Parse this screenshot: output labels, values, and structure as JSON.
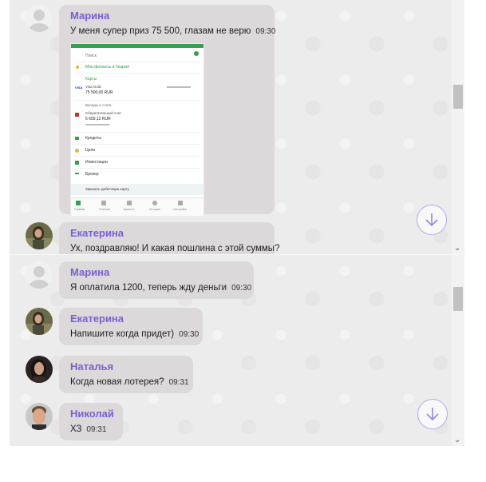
{
  "top_chat": {
    "messages": [
      {
        "name": "Марина",
        "text": "У меня супер приз 75 500, глазам не верю",
        "time": "09:30",
        "avatar": "default-avatar-icon"
      },
      {
        "name": "Екатерина",
        "text": "Ух, поздравляю! И какая пошлина с этой суммы?",
        "time": "",
        "avatar": "user-photo"
      }
    ],
    "scroll_button": "scroll-down-icon"
  },
  "screenshot_app": {
    "menu_items": [
      "Поиск",
      "Мои финансы в бюджет",
      "Карты",
      "Вклады и счета",
      "Кредиты",
      "Цели",
      "Инвестиции",
      "Брокер"
    ],
    "card_label": "Visa Gold",
    "card_amount": "75 500,00 RUR",
    "account_label": "Сберегательный счет",
    "account_amount": "6 659,12 RUR",
    "footer": "Заказать дебетовую карту",
    "tabs": [
      "Главная",
      "Платежи",
      "Диалоги",
      "История",
      "Настройки"
    ]
  },
  "bottom_chat": {
    "messages": [
      {
        "name": "Марина",
        "text": "Я оплатила 1200, теперь жду деньги",
        "time": "09:30"
      },
      {
        "name": "Екатерина",
        "text": "Напишите когда придет)",
        "time": "09:30"
      },
      {
        "name": "Наталья",
        "text": "Когда новая лотерея?",
        "time": "09:31"
      },
      {
        "name": "Николай",
        "text": "ХЗ",
        "time": "09:31"
      }
    ]
  },
  "colors": {
    "name": "#7a5fcf",
    "bubble": "#ddd9da",
    "background": "#ececec",
    "accent": "#b8a6e8",
    "app_green": "#35a04f"
  }
}
